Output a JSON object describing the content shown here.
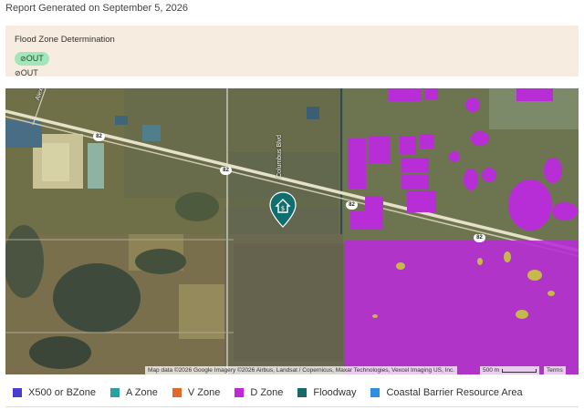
{
  "report": {
    "generated": "Report Generated on September 5, 2026"
  },
  "flood_panel": {
    "title": "Flood Zone Determination",
    "badge": "OUT",
    "plain": "OUT",
    "check_icon": "⊘"
  },
  "map": {
    "road_labels": {
      "alexander": "Alexander",
      "columbus": "Columbus Blvd"
    },
    "route_shield": "82",
    "attribution": "Map data ©2026 Google Imagery ©2026 Airbus, Landsat / Copernicus, Maxar Technologies, Vexcel Imaging US, Inc.",
    "scale_label": "500 m",
    "terms": "Terms"
  },
  "legend": [
    {
      "label": "X500 or BZone",
      "color": "#4b3dd3"
    },
    {
      "label": "A Zone",
      "color": "#2aa0a3"
    },
    {
      "label": "V Zone",
      "color": "#e2682b"
    },
    {
      "label": "D Zone",
      "color": "#c028d9"
    },
    {
      "label": "Floodway",
      "color": "#176b64"
    },
    {
      "label": "Coastal Barrier Resource Area",
      "color": "#2f8fde"
    }
  ]
}
